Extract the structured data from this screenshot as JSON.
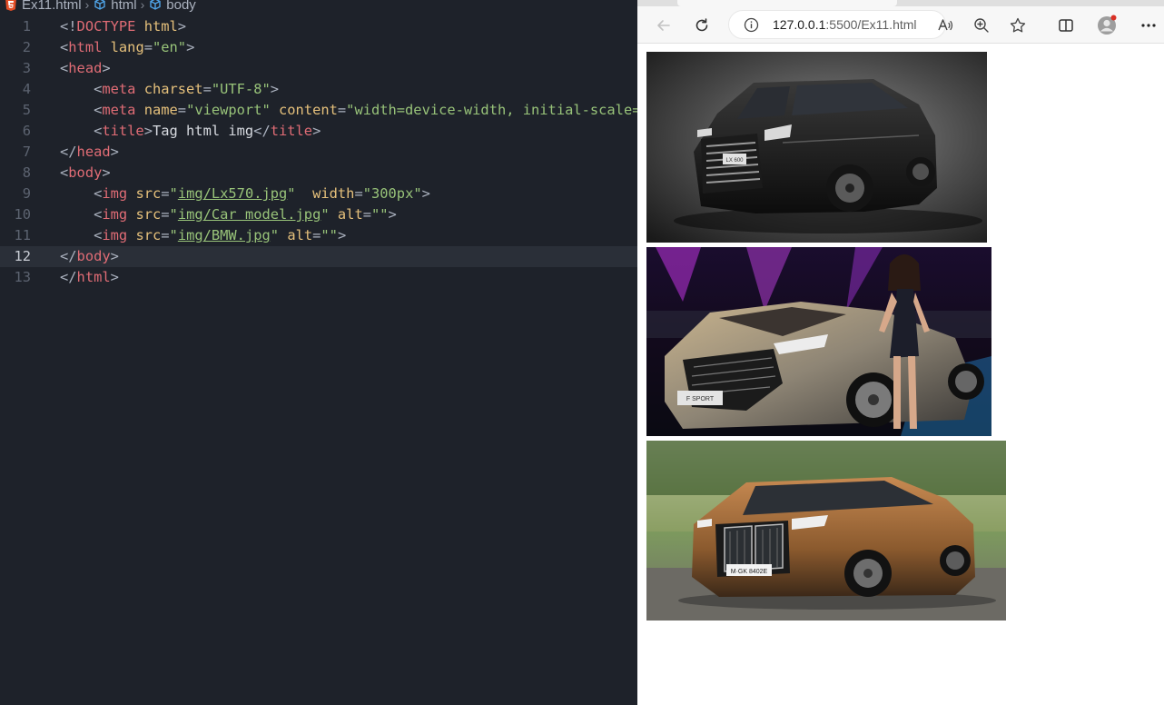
{
  "editor": {
    "breadcrumb": {
      "file": "Ex11.html",
      "item2": "html",
      "item3": "body"
    },
    "active_line": 12,
    "lines": [
      {
        "num": "1",
        "tokens": [
          [
            "br",
            "<!"
          ],
          [
            "doc",
            "DOCTYPE"
          ],
          [
            "br",
            " "
          ],
          [
            "attr",
            "html"
          ],
          [
            "br",
            ">"
          ]
        ]
      },
      {
        "num": "2",
        "tokens": [
          [
            "br",
            "<"
          ],
          [
            "tag",
            "html"
          ],
          [
            "br",
            " "
          ],
          [
            "attr",
            "lang"
          ],
          [
            "br",
            "="
          ],
          [
            "str",
            "\"en\""
          ],
          [
            "br",
            ">"
          ]
        ]
      },
      {
        "num": "3",
        "tokens": [
          [
            "br",
            "<"
          ],
          [
            "tag",
            "head"
          ],
          [
            "br",
            ">"
          ]
        ]
      },
      {
        "num": "4",
        "tokens": [
          [
            "br",
            "    <"
          ],
          [
            "tag",
            "meta"
          ],
          [
            "br",
            " "
          ],
          [
            "attr",
            "charset"
          ],
          [
            "br",
            "="
          ],
          [
            "str",
            "\"UTF-8\""
          ],
          [
            "br",
            ">"
          ]
        ]
      },
      {
        "num": "5",
        "tokens": [
          [
            "br",
            "    <"
          ],
          [
            "tag",
            "meta"
          ],
          [
            "br",
            " "
          ],
          [
            "attr",
            "name"
          ],
          [
            "br",
            "="
          ],
          [
            "str",
            "\"viewport\""
          ],
          [
            "br",
            " "
          ],
          [
            "attr",
            "content"
          ],
          [
            "br",
            "="
          ],
          [
            "str",
            "\"width=device-width, initial-scale="
          ]
        ]
      },
      {
        "num": "6",
        "tokens": [
          [
            "br",
            "    <"
          ],
          [
            "tag",
            "title"
          ],
          [
            "br",
            ">"
          ],
          [
            "text",
            "Tag html img"
          ],
          [
            "br",
            "</"
          ],
          [
            "tag",
            "title"
          ],
          [
            "br",
            ">"
          ]
        ]
      },
      {
        "num": "7",
        "tokens": [
          [
            "br",
            "</"
          ],
          [
            "tag",
            "head"
          ],
          [
            "br",
            ">"
          ]
        ]
      },
      {
        "num": "8",
        "tokens": [
          [
            "br",
            "<"
          ],
          [
            "tag",
            "body"
          ],
          [
            "br",
            ">"
          ]
        ]
      },
      {
        "num": "9",
        "tokens": [
          [
            "br",
            "    <"
          ],
          [
            "tag",
            "img"
          ],
          [
            "br",
            " "
          ],
          [
            "attr",
            "src"
          ],
          [
            "br",
            "="
          ],
          [
            "str",
            "\""
          ],
          [
            "link",
            "img/Lx570.jpg"
          ],
          [
            "str",
            "\""
          ],
          [
            "br",
            "  "
          ],
          [
            "attr",
            "width"
          ],
          [
            "br",
            "="
          ],
          [
            "str",
            "\"300px\""
          ],
          [
            "br",
            ">"
          ]
        ]
      },
      {
        "num": "10",
        "tokens": [
          [
            "br",
            "    <"
          ],
          [
            "tag",
            "img"
          ],
          [
            "br",
            " "
          ],
          [
            "attr",
            "src"
          ],
          [
            "br",
            "="
          ],
          [
            "str",
            "\""
          ],
          [
            "link",
            "img/Car model.jpg"
          ],
          [
            "str",
            "\""
          ],
          [
            "br",
            " "
          ],
          [
            "attr",
            "alt"
          ],
          [
            "br",
            "="
          ],
          [
            "str",
            "\"\""
          ],
          [
            "br",
            ">"
          ]
        ]
      },
      {
        "num": "11",
        "tokens": [
          [
            "br",
            "    <"
          ],
          [
            "tag",
            "img"
          ],
          [
            "br",
            " "
          ],
          [
            "attr",
            "src"
          ],
          [
            "br",
            "="
          ],
          [
            "str",
            "\""
          ],
          [
            "link",
            "img/BMW.jpg"
          ],
          [
            "str",
            "\""
          ],
          [
            "br",
            " "
          ],
          [
            "attr",
            "alt"
          ],
          [
            "br",
            "="
          ],
          [
            "str",
            "\"\""
          ],
          [
            "br",
            ">"
          ]
        ]
      },
      {
        "num": "12",
        "tokens": [
          [
            "br",
            "</"
          ],
          [
            "tag",
            "body"
          ],
          [
            "br",
            ">"
          ]
        ]
      },
      {
        "num": "13",
        "tokens": [
          [
            "br",
            "</"
          ],
          [
            "tag",
            "html"
          ],
          [
            "br",
            ">"
          ]
        ]
      }
    ]
  },
  "browser": {
    "url_host": "127.0.0.1",
    "url_rest": ":5500/Ex11.html",
    "icons": [
      "back-arrow-icon",
      "refresh-icon",
      "info-icon",
      "read-aloud-icon",
      "zoom-icon",
      "favorite-star-icon",
      "split-screen-icon",
      "profile-avatar-icon",
      "more-icon"
    ],
    "images": [
      {
        "name": "lexus-lx-black-suv-image"
      },
      {
        "name": "lexus-rx-fsport-with-model-image"
      },
      {
        "name": "bmw-7-series-bronze-image"
      }
    ],
    "plate_texts": {
      "lx": "LX 600",
      "rx": "F SPORT",
      "bmw": "M·GK 8402E"
    }
  },
  "colors": {
    "editor_bg": "#1e222a",
    "tag": "#e06c75",
    "attr": "#e5c07b",
    "string": "#98c379",
    "bracket": "#abb2bf"
  }
}
